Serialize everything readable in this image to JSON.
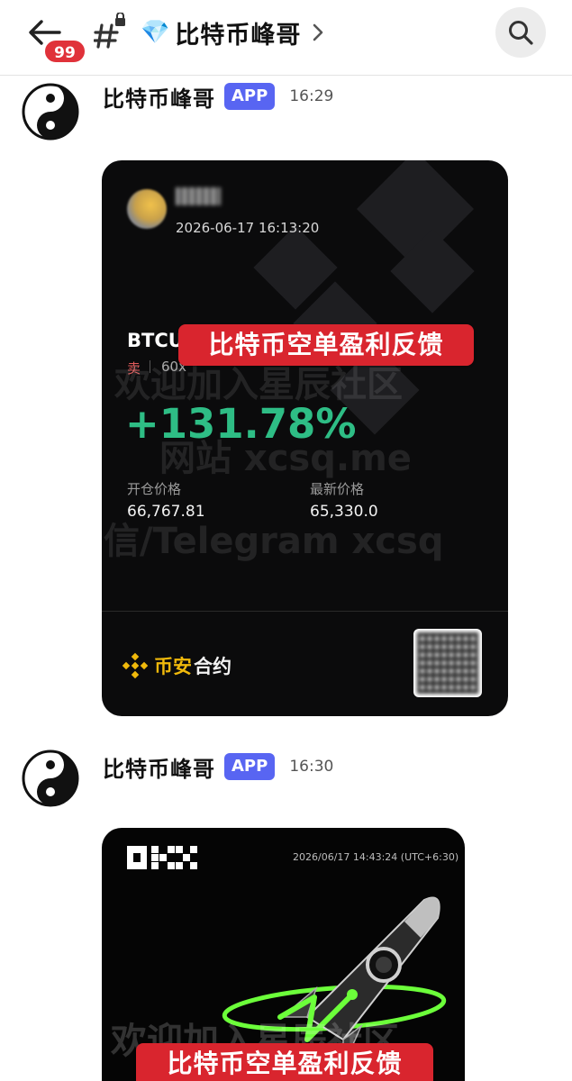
{
  "header": {
    "back_icon": "arrow-left-icon",
    "unread_badge": "99",
    "channel_icon": "hashtag-lock-icon",
    "channel_emoji": "💎",
    "channel_name": "比特币峰哥",
    "chevron_icon": "chevron-right-icon",
    "search_icon": "search-icon"
  },
  "messages": [
    {
      "sender": "比特币峰哥",
      "tag": "APP",
      "time": "16:29",
      "card": {
        "timestamp": "2026-06-17 16:13:20",
        "pair": "BTCU",
        "side": "卖",
        "leverage": "60x",
        "pnl_percent": "+131.78%",
        "entry_label": "开仓价格",
        "entry_value": "66,767.81",
        "latest_label": "最新价格",
        "latest_value": "65,330.0",
        "brand_part1": "币安",
        "brand_part2": "合约",
        "stamp": "比特币空单盈利反馈",
        "watermark_line1": "欢迎加入星辰社区",
        "watermark_line2": "网站 xcsq.me",
        "watermark_line3": "信/Telegram xcsq"
      }
    },
    {
      "sender": "比特币峰哥",
      "tag": "APP",
      "time": "16:30",
      "card": {
        "timestamp": "2026/06/17 14:43:24 (UTC+6:30)",
        "watermark_line1": "欢迎加入星辰社区",
        "stamp": "比特币空单盈利反馈"
      }
    }
  ],
  "colors": {
    "badge": "#e0323a",
    "app_tag": "#5865f2",
    "profit_green": "#2ebd85",
    "binance_yellow": "#f0b90b",
    "stamp_red": "#d9252e"
  }
}
